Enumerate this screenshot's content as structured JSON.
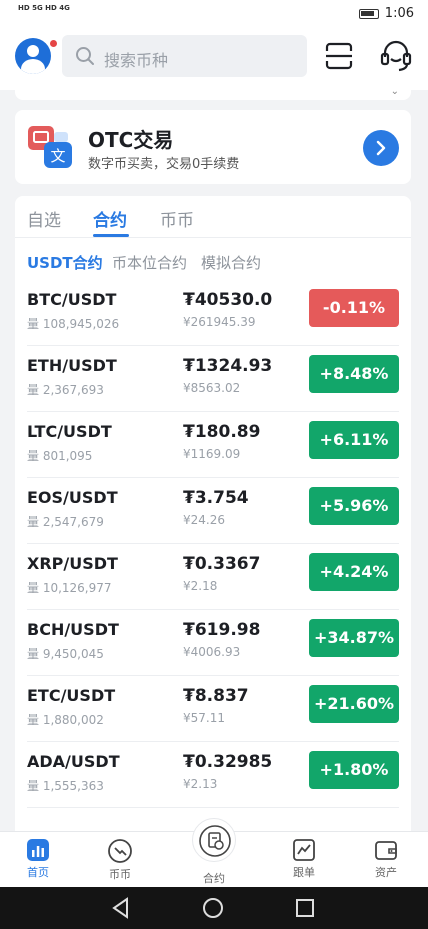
{
  "status_bar": {
    "left_indicators": "HD 5G  HD 4G",
    "time": "1:06"
  },
  "header": {
    "search_placeholder": "搜索币种"
  },
  "otc": {
    "title": "OTC交易",
    "subtitle": "数字币买卖，交易0手续费"
  },
  "tabs": [
    {
      "label": "自选",
      "active": false
    },
    {
      "label": "合约",
      "active": true
    },
    {
      "label": "币币",
      "active": false
    }
  ],
  "subtabs": [
    {
      "label": "USDT合约",
      "active": true
    },
    {
      "label": "币本位合约",
      "active": false
    },
    {
      "label": "模拟合约",
      "active": false
    }
  ],
  "colors": {
    "accent": "#2a7ae2",
    "up": "#12a66a",
    "down": "#e55a5a"
  },
  "market_rows": [
    {
      "pair": "BTC/USDT",
      "volume": "量 108,945,026",
      "price": "₮40530.0",
      "cny": "¥261945.39",
      "change": "-0.11%",
      "direction": "down"
    },
    {
      "pair": "ETH/USDT",
      "volume": "量 2,367,693",
      "price": "₮1324.93",
      "cny": "¥8563.02",
      "change": "+8.48%",
      "direction": "up"
    },
    {
      "pair": "LTC/USDT",
      "volume": "量 801,095",
      "price": "₮180.89",
      "cny": "¥1169.09",
      "change": "+6.11%",
      "direction": "up"
    },
    {
      "pair": "EOS/USDT",
      "volume": "量 2,547,679",
      "price": "₮3.754",
      "cny": "¥24.26",
      "change": "+5.96%",
      "direction": "up"
    },
    {
      "pair": "XRP/USDT",
      "volume": "量 10,126,977",
      "price": "₮0.3367",
      "cny": "¥2.18",
      "change": "+4.24%",
      "direction": "up"
    },
    {
      "pair": "BCH/USDT",
      "volume": "量 9,450,045",
      "price": "₮619.98",
      "cny": "¥4006.93",
      "change": "+34.87%",
      "direction": "up"
    },
    {
      "pair": "ETC/USDT",
      "volume": "量 1,880,002",
      "price": "₮8.837",
      "cny": "¥57.11",
      "change": "+21.60%",
      "direction": "up"
    },
    {
      "pair": "ADA/USDT",
      "volume": "量 1,555,363",
      "price": "₮0.32985",
      "cny": "¥2.13",
      "change": "+1.80%",
      "direction": "up"
    }
  ],
  "bottom_nav": [
    {
      "label": "首页",
      "icon": "home-chart-icon",
      "active": true
    },
    {
      "label": "币币",
      "icon": "coin-swap-icon",
      "active": false
    },
    {
      "label": "合约",
      "icon": "contract-icon",
      "active": false
    },
    {
      "label": "跟单",
      "icon": "trend-icon",
      "active": false
    },
    {
      "label": "资产",
      "icon": "wallet-icon",
      "active": false
    }
  ]
}
